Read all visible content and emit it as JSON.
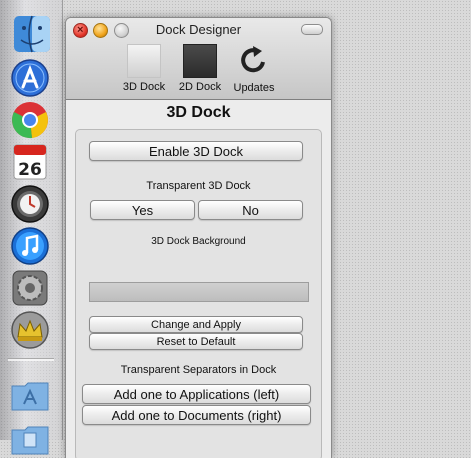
{
  "window": {
    "title": "Dock Designer",
    "view_title": "3D Dock"
  },
  "toolbar": {
    "items": [
      {
        "label": "3D Dock",
        "icon": "dock-3d-icon"
      },
      {
        "label": "2D Dock",
        "icon": "dock-2d-icon"
      },
      {
        "label": "Updates",
        "icon": "refresh-arrow-icon"
      }
    ]
  },
  "panel": {
    "enable_button": "Enable 3D Dock",
    "transparent_label": "Transparent 3D Dock",
    "yes_button": "Yes",
    "no_button": "No",
    "background_label": "3D Dock Background",
    "change_apply_button": "Change and Apply",
    "reset_button": "Reset to Default",
    "separators_label": "Transparent Separators in Dock",
    "add_apps_button": "Add one to Applications (left)",
    "add_docs_button": "Add one to Documents (right)"
  },
  "dock": {
    "calendar_day": "26",
    "items": [
      "finder-icon",
      "app-store-icon",
      "chrome-icon",
      "calendar-icon",
      "time-machine-icon",
      "itunes-icon",
      "system-preferences-icon",
      "crown-app-icon",
      "applications-folder-icon",
      "documents-folder-icon"
    ]
  },
  "colors": {
    "close": "#e3382c",
    "minimize": "#f0a41d",
    "zoom": "#cfcfcf",
    "window_bg": "#ececec"
  }
}
